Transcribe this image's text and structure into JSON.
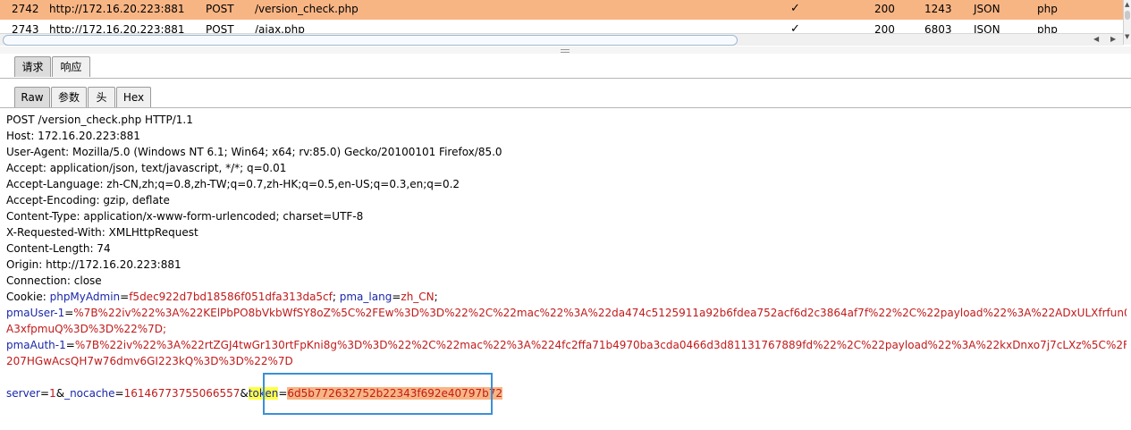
{
  "history": {
    "rows": [
      {
        "num": "2742",
        "host": "http://172.16.20.223:881",
        "method": "POST",
        "url": "/version_check.php",
        "check": "✓",
        "status": "200",
        "length": "1243",
        "mime": "JSON",
        "ext": "php"
      },
      {
        "num": "2743",
        "host": "http://172.16.20.223:881",
        "method": "POST",
        "url": "/ajax.php",
        "check": "✓",
        "status": "200",
        "length": "6803",
        "mime": "JSON",
        "ext": "php"
      }
    ]
  },
  "tabs_primary": {
    "request": "请求",
    "response": "响应"
  },
  "tabs_secondary": {
    "raw": "Raw",
    "params": "参数",
    "headers": "头",
    "hex": "Hex"
  },
  "request": {
    "request_line": "POST /version_check.php HTTP/1.1",
    "host": "Host: 172.16.20.223:881",
    "user_agent": "User-Agent: Mozilla/5.0 (Windows NT 6.1; Win64; x64; rv:85.0) Gecko/20100101 Firefox/85.0",
    "accept": "Accept: application/json, text/javascript, */*; q=0.01",
    "accept_language": "Accept-Language: zh-CN,zh;q=0.8,zh-TW;q=0.7,zh-HK;q=0.5,en-US;q=0.3,en;q=0.2",
    "accept_encoding": "Accept-Encoding: gzip, deflate",
    "content_type": "Content-Type: application/x-www-form-urlencoded; charset=UTF-8",
    "x_requested_with": "X-Requested-With: XMLHttpRequest",
    "content_length": "Content-Length: 74",
    "origin": "Origin: http://172.16.20.223:881",
    "connection": "Connection: close",
    "cookie_label": "Cookie: ",
    "cookie_k1": "phpMyAdmin",
    "cookie_v1": "f5dec922d7bd18586f051dfa313da5cf",
    "cookie_sep1": "; ",
    "cookie_k2": "pma_lang",
    "cookie_v2": "zh_CN",
    "cookie_sep2": ";",
    "pmauser_k": "pmaUser-1",
    "pmauser_v1": "%7B%22iv%22%3A%22KElPbPO8bVkbWfSY8oZ%5C%2FEw%3D%3D%22%2C%22mac%22%3A%22da474c5125911a92b6fdea752acf6d2c3864af7f%22%2C%22payload%22%3A%22ADxULXfrfun0FI",
    "pmauser_v2": "A3xfpmuQ%3D%3D%22%7D;",
    "pmaauth_k": "pmaAuth-1",
    "pmaauth_v1": "%7B%22iv%22%3A%22rtZGJ4twGr130rtFpKni8g%3D%3D%22%2C%22mac%22%3A%224fc2ffa71b4970ba3cda0466d3d81131767889fd%22%2C%22payload%22%3A%22kxDnxo7j7cLXz%5C%2Fd6p",
    "pmaauth_v2": "207HGwAcsQH7w76dmv6GI223kQ%3D%3D%22%7D",
    "body_k1": "server",
    "body_v1": "1",
    "body_k2": "_nocache",
    "body_v2": "16146773755066557",
    "body_k3": "token",
    "body_v3": "6d5b772632752b22343f692e40797b72"
  },
  "colors": {
    "selected_row": "#f8b584",
    "param_name": "#1a28a8",
    "param_value": "#c21a1a",
    "highlight_yellow": "#ffff44",
    "focus_box": "#3b8fd8"
  }
}
